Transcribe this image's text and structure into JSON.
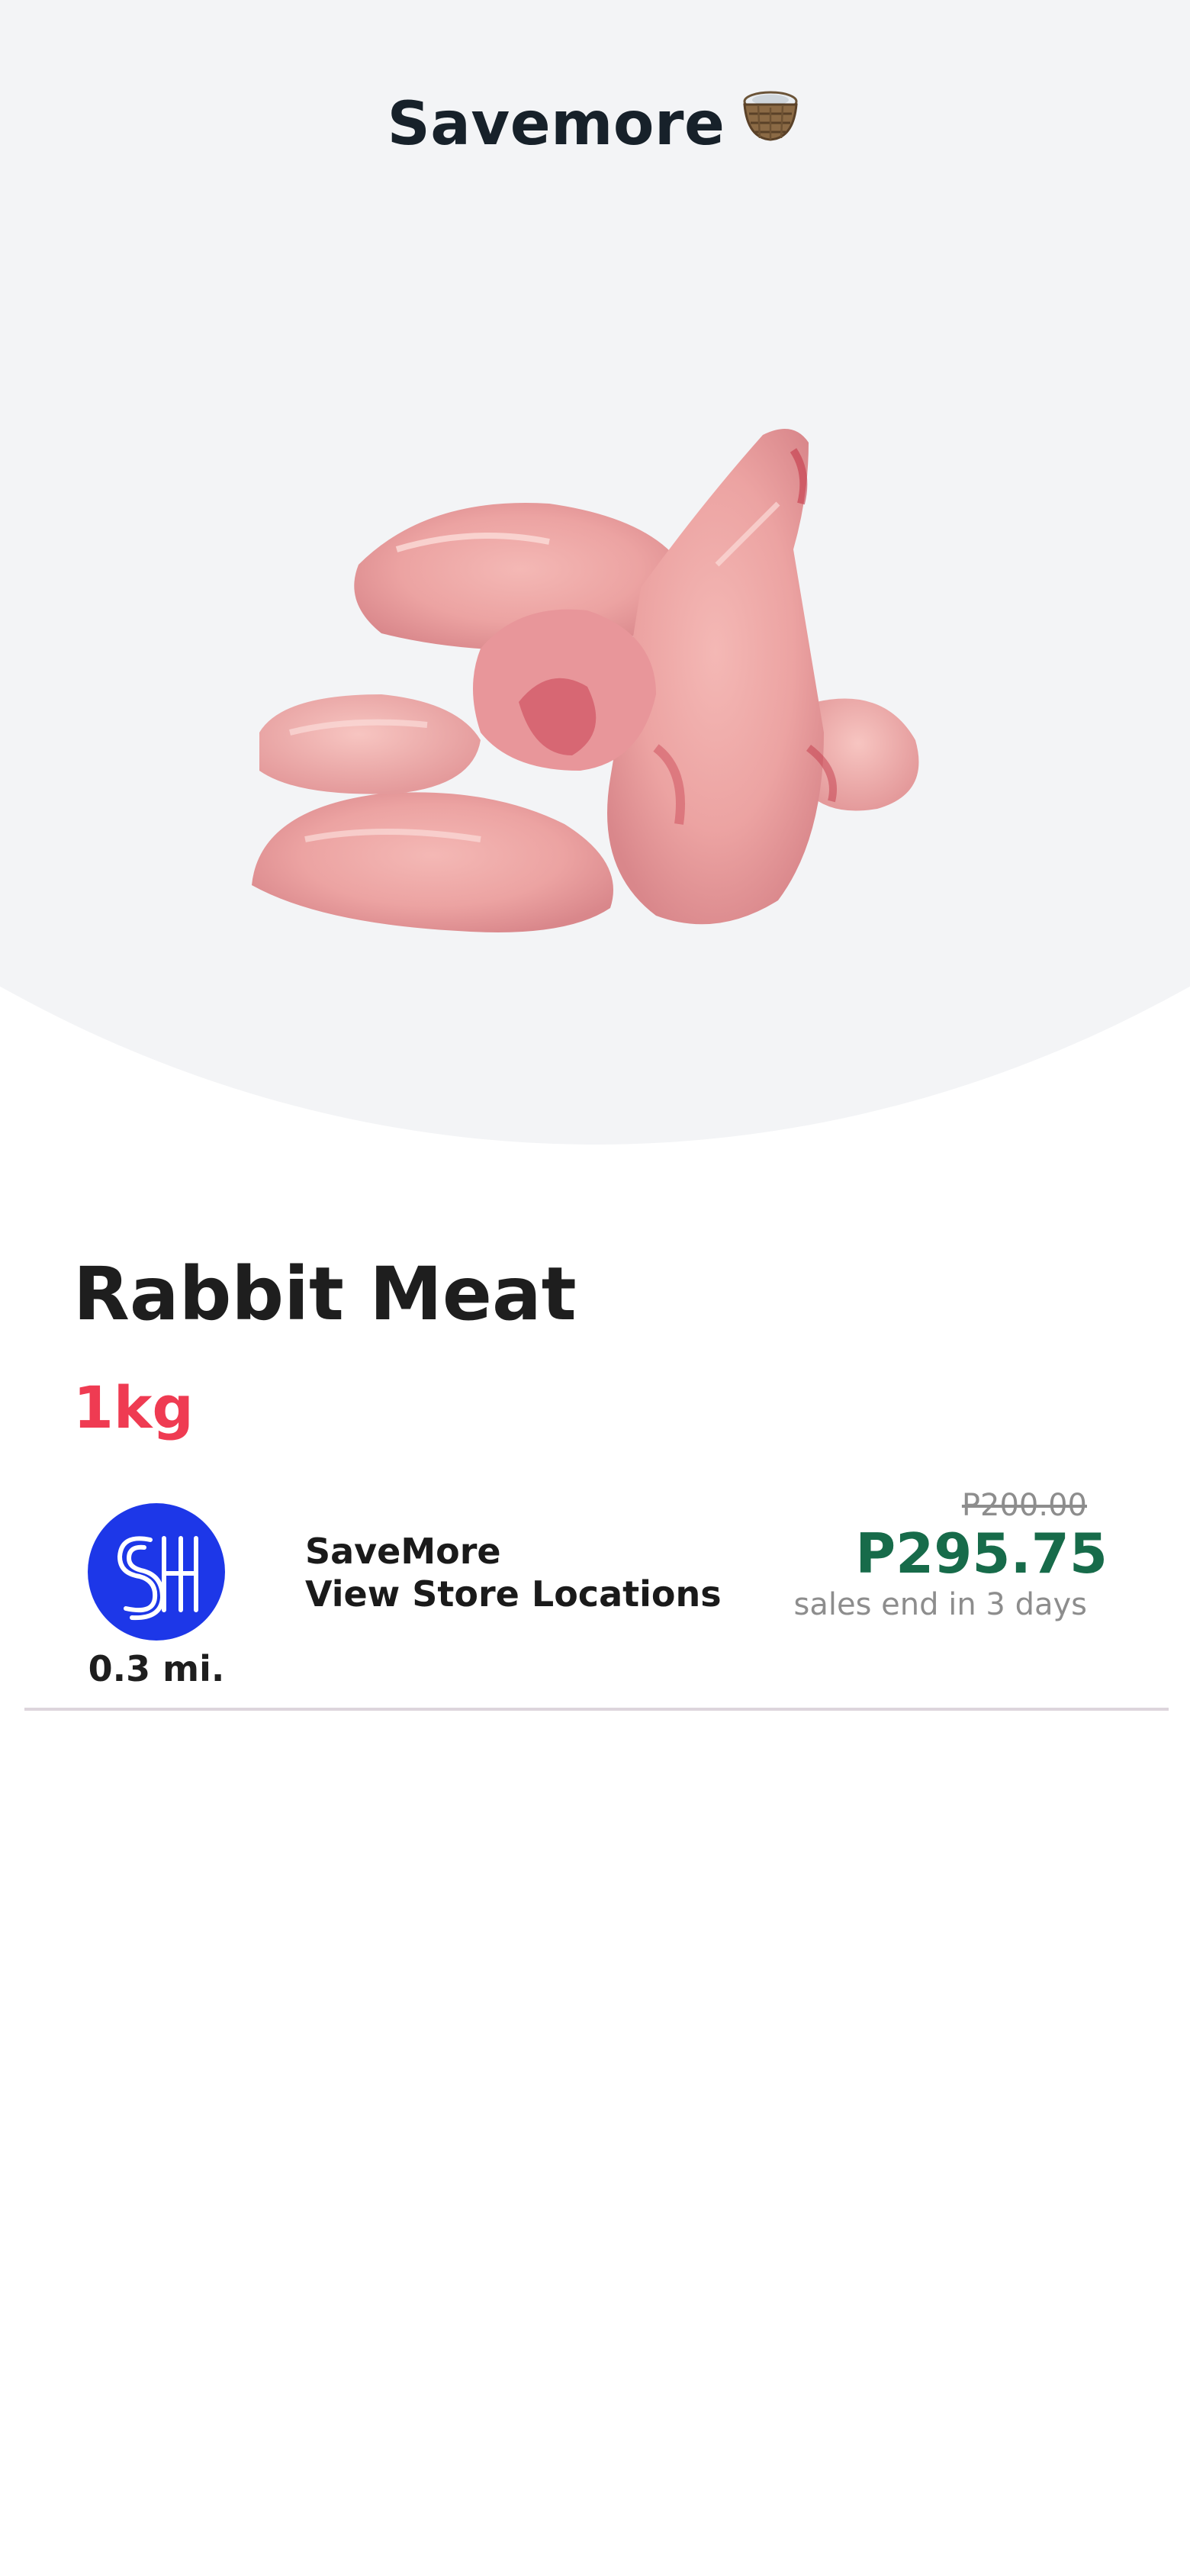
{
  "header": {
    "title": "Savemore",
    "title_icon": "basket-icon"
  },
  "product": {
    "image_icon": "rabbit-meat-image",
    "name": "Rabbit Meat",
    "size": "1kg"
  },
  "store": {
    "logo_icon": "savemore-sm-logo",
    "distance": "0.3 mi.",
    "name": "SaveMore",
    "link_label": "View Store Locations"
  },
  "pricing": {
    "old_price": "P200.00",
    "new_price": "P295.75",
    "sale_note": "sales end in 3 days"
  },
  "colors": {
    "hero_bg": "#f3f4f6",
    "size_red": "#ef3b52",
    "price_green": "#176b4a",
    "logo_blue": "#1d37e8",
    "muted_grey": "#8d8d8d"
  }
}
